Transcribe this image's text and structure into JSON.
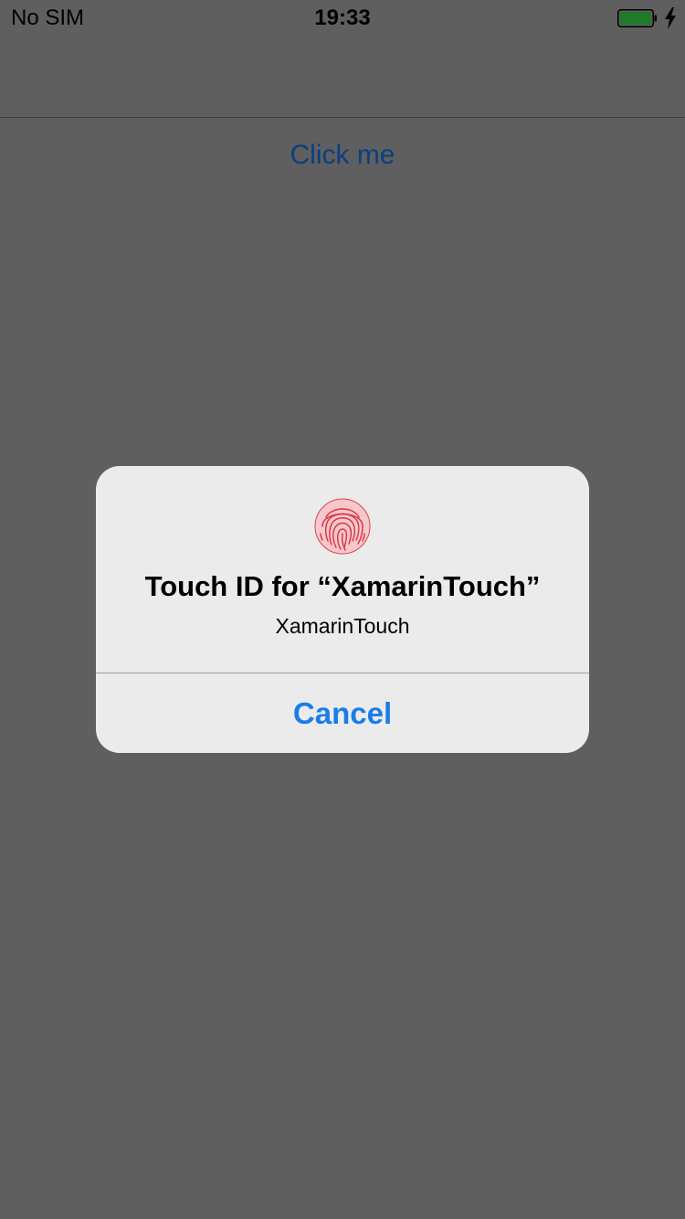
{
  "status_bar": {
    "carrier": "No SIM",
    "time": "19:33",
    "battery_icon": "battery-charging-icon",
    "battery_level": 1.0
  },
  "main": {
    "button_label": "Click me",
    "link_color": "#0a3f80"
  },
  "alert": {
    "icon": "fingerprint-icon",
    "title": "Touch ID for “XamarinTouch”",
    "message": "XamarinTouch",
    "cancel_label": "Cancel",
    "cancel_color": "#1a7ee8",
    "fingerprint_color": "#e0424e"
  }
}
